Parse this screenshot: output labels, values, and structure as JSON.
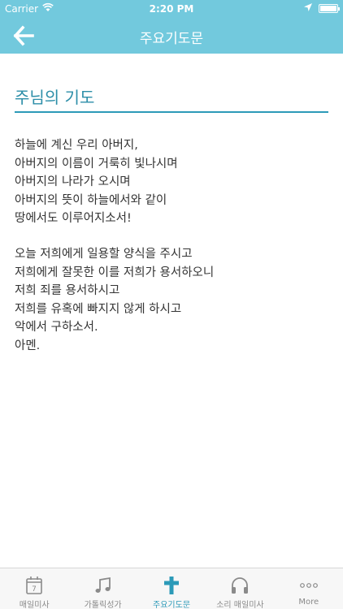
{
  "status_bar": {
    "carrier": "Carrier",
    "time": "2:20 PM"
  },
  "nav": {
    "title": "주요기도문",
    "back_icon": "arrow-left-icon"
  },
  "prayer": {
    "title": "주님의 기도",
    "stanza1": [
      "하늘에 계신 우리 아버지,",
      "아버지의 이름이 거룩히 빛나시며",
      "아버지의 나라가 오시며",
      "아버지의 뜻이 하늘에서와 같이",
      "땅에서도 이루어지소서!"
    ],
    "stanza2": [
      "오늘 저희에게 일용할 양식을 주시고",
      "저희에게 잘못한 이를 저희가 용서하오니",
      "저희 죄를 용서하시고",
      "저희를 유혹에 빠지지 않게 하시고",
      "악에서 구하소서.",
      "아멘."
    ]
  },
  "tabs": [
    {
      "label": "매일미사",
      "icon": "calendar-icon",
      "calendar_day": "7",
      "active": false
    },
    {
      "label": "가톨릭성가",
      "icon": "music-note-icon",
      "active": false
    },
    {
      "label": "주요기도문",
      "icon": "cross-icon",
      "active": true
    },
    {
      "label": "소리 매일미사",
      "icon": "headphones-icon",
      "active": false
    },
    {
      "label": "More",
      "icon": "more-dots-icon",
      "active": false
    }
  ],
  "colors": {
    "header": "#72c9dd",
    "accent": "#2c9ab8",
    "tab_inactive": "#8a8a8a"
  }
}
